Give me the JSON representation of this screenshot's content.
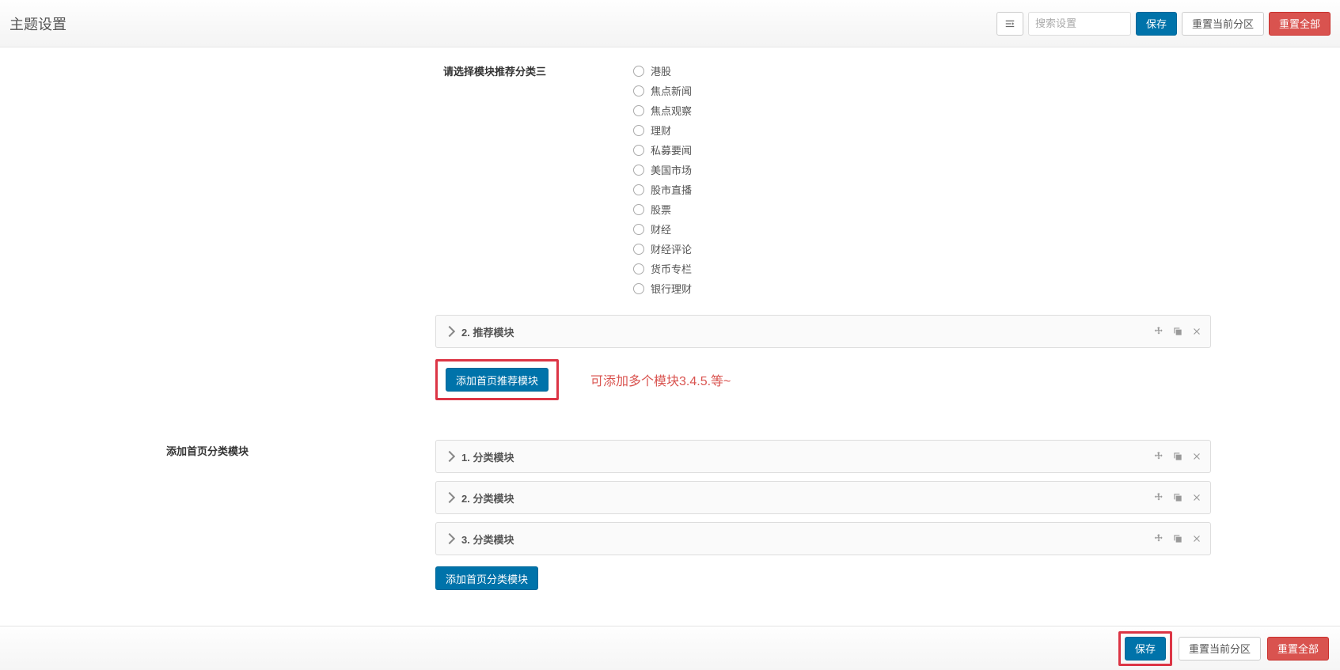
{
  "header": {
    "title": "主题设置",
    "search_placeholder": "搜索设置",
    "save_label": "保存",
    "reset_current_label": "重置当前分区",
    "reset_all_label": "重置全部"
  },
  "radio_group": {
    "label": "请选择模块推荐分类三",
    "options": [
      "港股",
      "焦点新闻",
      "焦点观察",
      "理财",
      "私募要闻",
      "美国市场",
      "股市直播",
      "股票",
      "财经",
      "财经评论",
      "货币专栏",
      "银行理财"
    ]
  },
  "recommend_modules": {
    "item_title": "2. 推荐模块",
    "add_button": "添加首页推荐模块",
    "hint": "可添加多个模块3.4.5.等~"
  },
  "category_section": {
    "label": "添加首页分类模块",
    "items": [
      "1. 分类模块",
      "2. 分类模块",
      "3. 分类模块"
    ],
    "add_button": "添加首页分类模块"
  },
  "footer": {
    "save_label": "保存",
    "reset_current_label": "重置当前分区",
    "reset_all_label": "重置全部"
  }
}
